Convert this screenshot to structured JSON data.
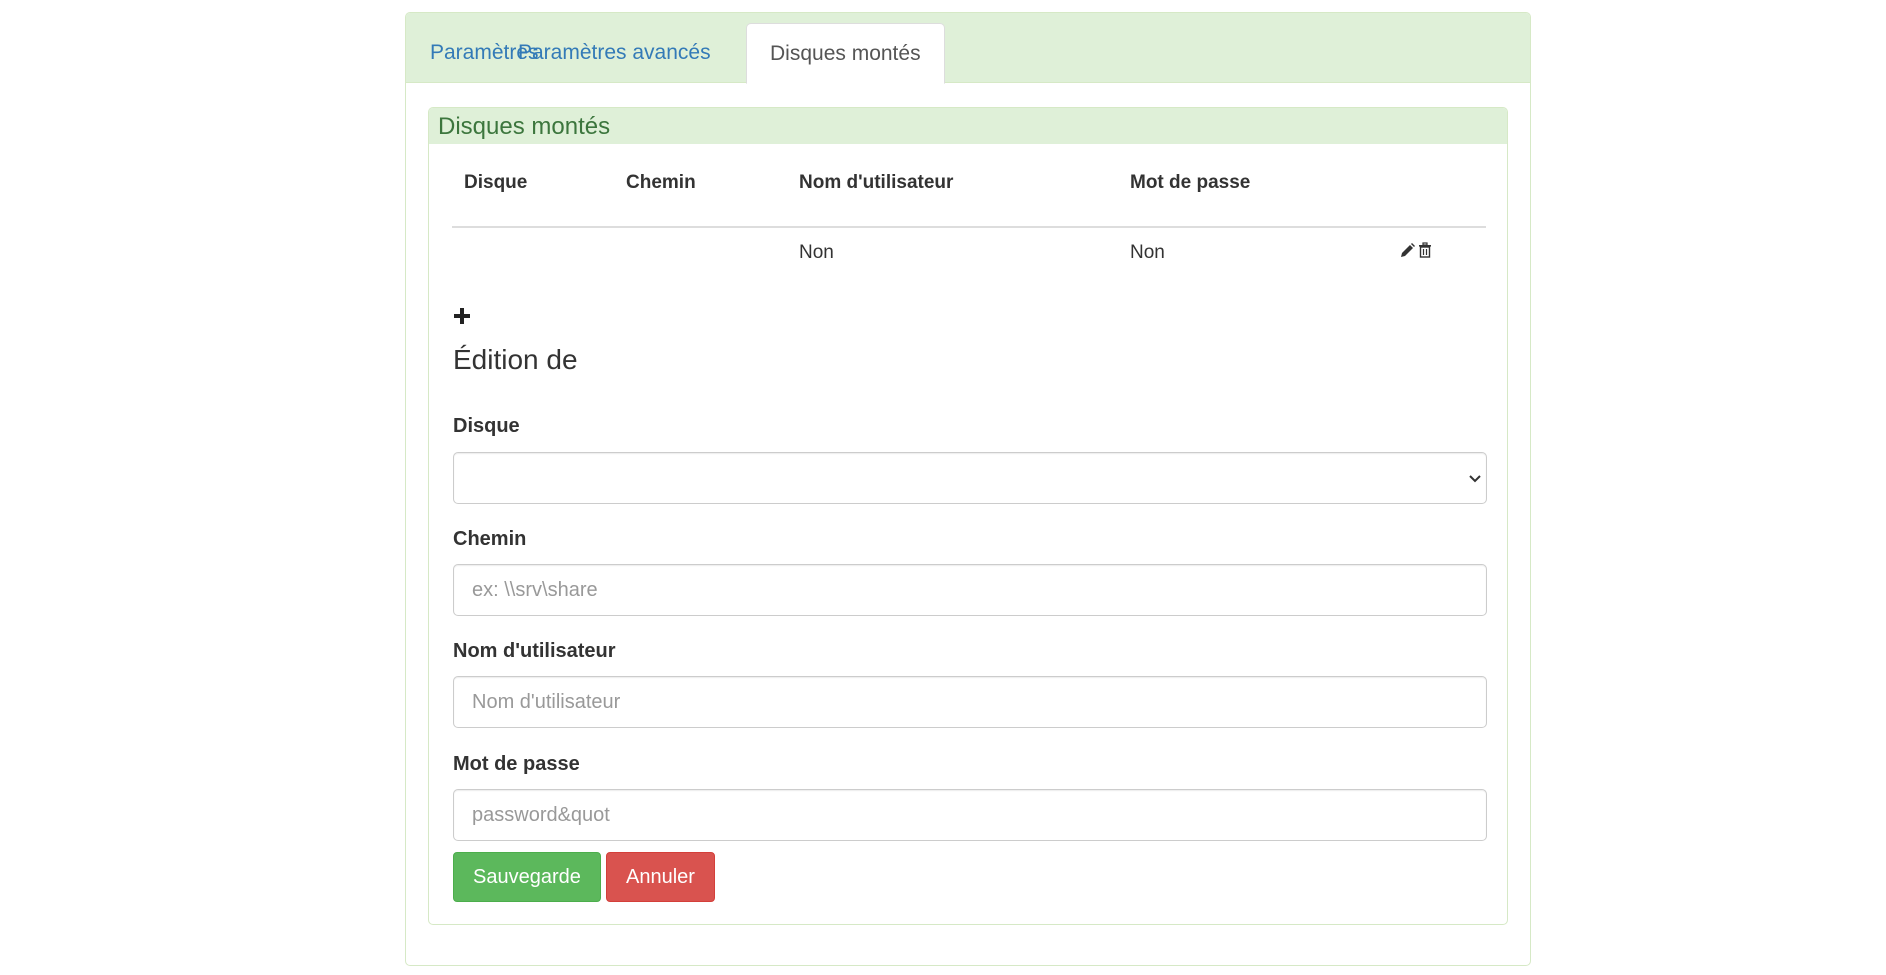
{
  "tabs": [
    {
      "label": "Paramètres",
      "active": false
    },
    {
      "label": "Paramètres avancés",
      "active": false
    },
    {
      "label": "Disques montés",
      "active": true
    }
  ],
  "section": {
    "title": "Disques montés"
  },
  "table": {
    "headers": [
      "Disque",
      "Chemin",
      "Nom d'utilisateur",
      "Mot de passe"
    ],
    "rows": [
      {
        "disque": "",
        "chemin": "",
        "username": "Non",
        "password": "Non"
      }
    ]
  },
  "icons": {
    "add": "plus-icon",
    "edit": "pencil-icon",
    "delete": "trash-icon"
  },
  "form": {
    "title": "Édition de",
    "disque": {
      "label": "Disque",
      "value": ""
    },
    "chemin": {
      "label": "Chemin",
      "placeholder": "ex: \\\\srv\\share"
    },
    "username": {
      "label": "Nom d'utilisateur",
      "placeholder": "Nom d'utilisateur"
    },
    "password": {
      "label": "Mot de passe",
      "placeholder": "password&quot"
    },
    "save_label": "Sauvegarde",
    "cancel_label": "Annuler"
  },
  "colors": {
    "panel_green": "#dff0d8",
    "panel_border": "#d6e9c6",
    "heading_text": "#3c763d",
    "link": "#337ab7",
    "save": "#5cb85c",
    "cancel": "#d9534f"
  }
}
